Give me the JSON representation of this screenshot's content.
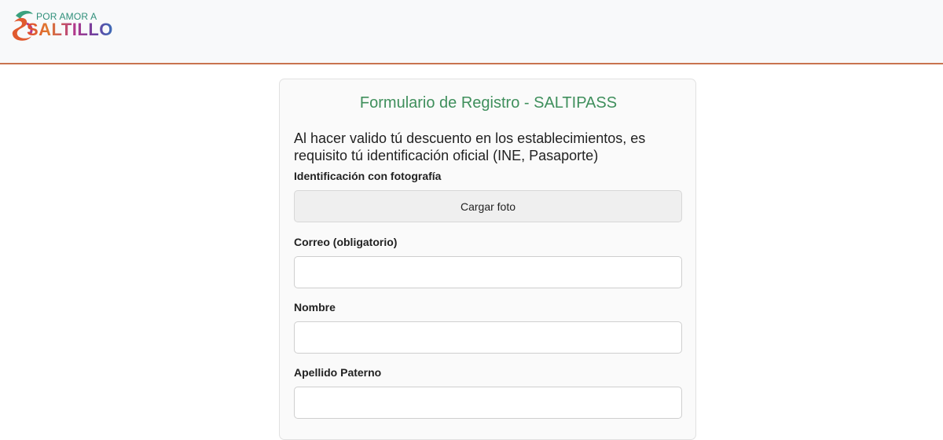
{
  "header": {
    "logo": {
      "top_text": "POR AMOR A",
      "bottom_text": "SALTILLO"
    },
    "border_color": "#c8734f"
  },
  "form": {
    "title": "Formulario de Registro - SALTIPASS",
    "intro": "Al hacer valido tú descuento en los establecimientos, es requisito tú identificación oficial (INE, Pasaporte)",
    "photo_id": {
      "label": "Identificación con fotografía",
      "button_label": "Cargar foto"
    },
    "email": {
      "label": "Correo (obligatorio)",
      "value": "",
      "placeholder": ""
    },
    "first_name": {
      "label": "Nombre",
      "value": "",
      "placeholder": ""
    },
    "last_name": {
      "label": "Apellido Paterno",
      "value": "",
      "placeholder": ""
    }
  },
  "colors": {
    "title_green": "#3f8f5c"
  }
}
